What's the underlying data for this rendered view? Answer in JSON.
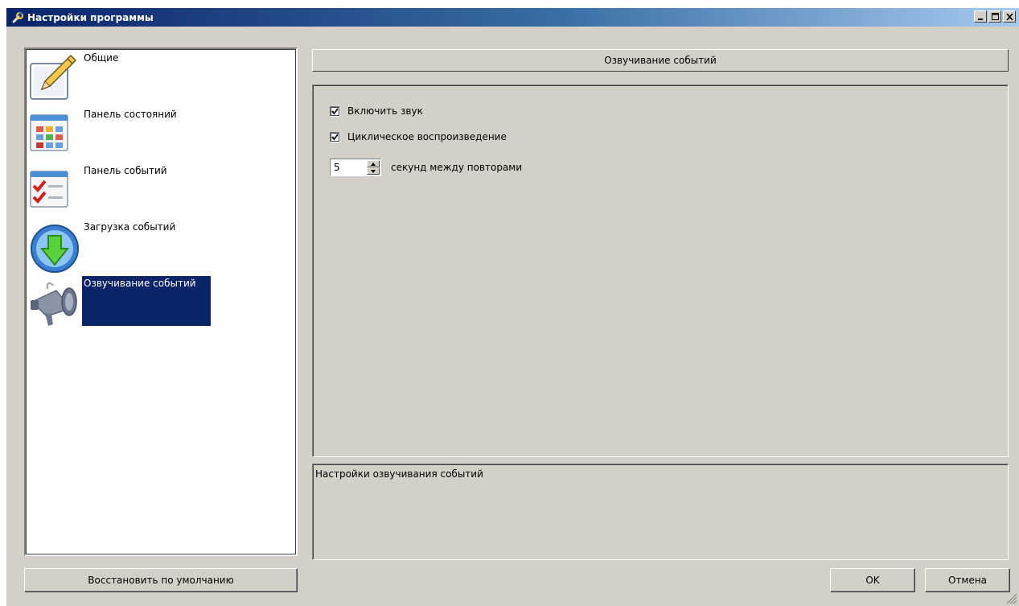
{
  "window": {
    "title": "Настройки программы",
    "controls": {
      "minimize": "_",
      "maximize": "□",
      "close": "x"
    }
  },
  "nav": {
    "items": [
      {
        "label": "Общие",
        "icon": "pencil-icon"
      },
      {
        "label": "Панель состояний",
        "icon": "status-panel-icon"
      },
      {
        "label": "Панель событий",
        "icon": "event-panel-icon"
      },
      {
        "label": "Загрузка событий",
        "icon": "download-globe-icon"
      },
      {
        "label": "Озвучивание событий",
        "icon": "megaphone-icon",
        "selected": true
      }
    ]
  },
  "section": {
    "title": "Озвучивание событий"
  },
  "settings": {
    "enable_sound": {
      "label": "Включить звук",
      "checked": true
    },
    "loop_playback": {
      "label": "Циклическое воспроизведение",
      "checked": true
    },
    "repeat_interval": {
      "value": "5",
      "label": "секунд между повторами"
    }
  },
  "description": "Настройки озвучивания событий",
  "buttons": {
    "restore_defaults": "Восстановить по умолчанию",
    "ok": "OK",
    "cancel": "Отмена"
  },
  "colors": {
    "face": "#d4d0c8",
    "selection": "#0a246a",
    "title_start": "#0a246a",
    "title_end": "#a6caf0"
  }
}
